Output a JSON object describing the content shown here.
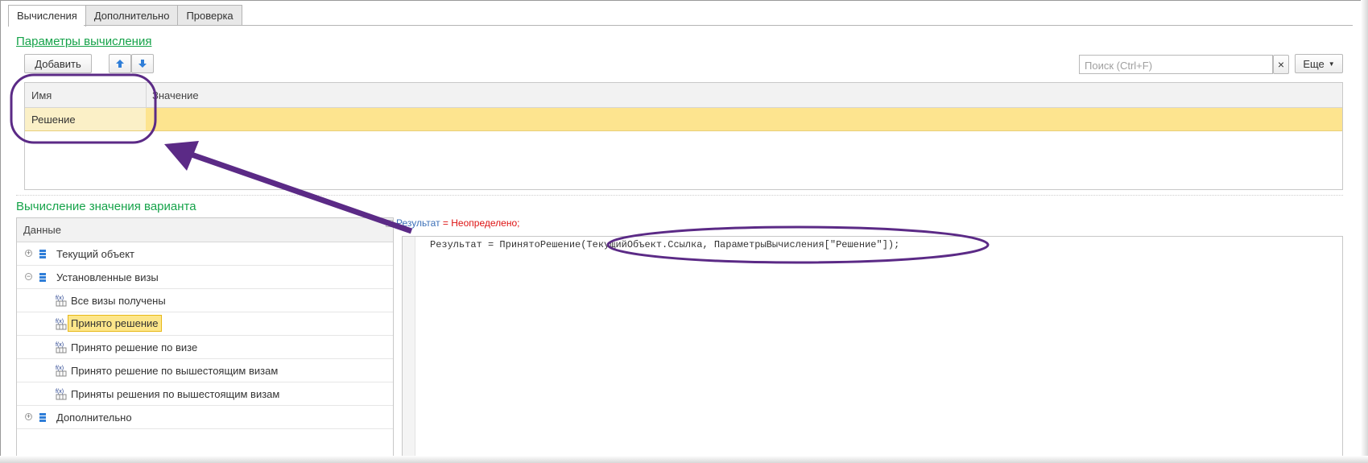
{
  "tabs": [
    "Вычисления",
    "Дополнительно",
    "Проверка"
  ],
  "params_section": {
    "title": "Параметры вычисления",
    "add_label": "Добавить",
    "up_icon": "arrow-up-icon",
    "down_icon": "arrow-down-icon",
    "search_placeholder": "Поиск (Ctrl+F)",
    "clear_label": "×",
    "more_label": "Еще",
    "table": {
      "columns": [
        "Имя",
        "Значение"
      ],
      "rows": [
        {
          "name": "Решение",
          "value": ""
        }
      ]
    }
  },
  "variant_section": {
    "title": "Вычисление значения варианта",
    "tree_header": "Данные",
    "tree": [
      {
        "label": "Текущий объект",
        "kind": "db",
        "expanded": false
      },
      {
        "label": "Установленные визы",
        "kind": "db",
        "expanded": true
      },
      {
        "label": "Все визы получены",
        "kind": "fx"
      },
      {
        "label": "Принято решение",
        "kind": "fx",
        "selected": true
      },
      {
        "label": "Принято решение по визе",
        "kind": "fx"
      },
      {
        "label": "Принято решение по вышестоящим визам",
        "kind": "fx"
      },
      {
        "label": "Приняты решения по вышестоящим визам",
        "kind": "fx"
      },
      {
        "label": "Дополнительно",
        "kind": "db",
        "expanded": false
      }
    ],
    "code_hint_part1": "Результат",
    "code_hint_part2": "= Неопределено;",
    "code_line": "Результат = ПринятоРешение(ТекущийОбъект.Ссылка, ПараметрыВычисления[\"Решение\"]);"
  },
  "colors": {
    "section_title": "#16a34a",
    "selected_row": "#fde48f",
    "annotation": "#5b2a86"
  }
}
